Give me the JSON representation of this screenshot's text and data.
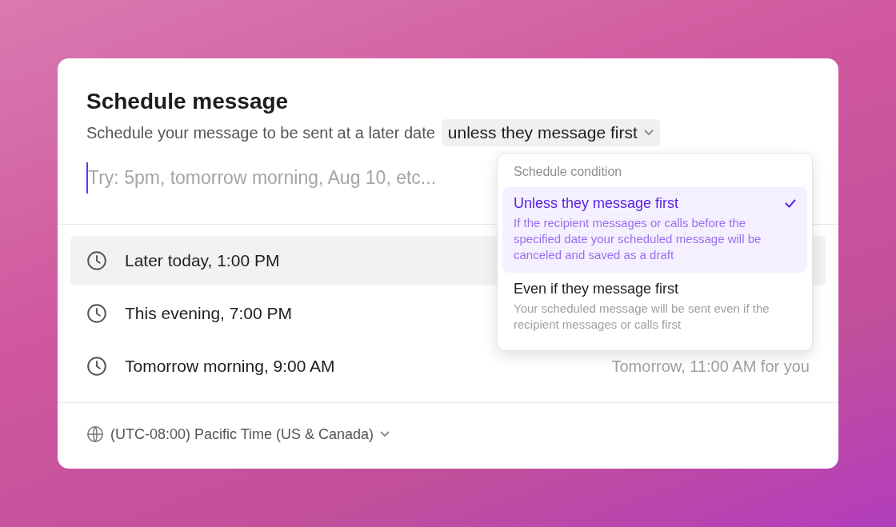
{
  "dialog": {
    "title": "Schedule message",
    "subtitle": "Schedule your message to be sent at a later date",
    "condition_button": "unless they message first",
    "input": {
      "placeholder": "Try: 5pm, tomorrow morning, Aug 10, etc..."
    }
  },
  "options": [
    {
      "label": "Later today, 1:00 PM",
      "selected": true
    },
    {
      "label": "This evening, 7:00 PM",
      "selected": false
    },
    {
      "label": "Tomorrow morning, 9:00 AM",
      "selected": false,
      "local_time": "Tomorrow, 11:00 AM for you"
    }
  ],
  "timezone": "(UTC-08:00) Pacific Time (US & Canada)",
  "menu": {
    "heading": "Schedule condition",
    "items": [
      {
        "title": "Unless they message first",
        "description": "If the recipient messages or calls before the specified date your scheduled message will be canceled and saved as a draft",
        "selected": true
      },
      {
        "title": "Even if they message first",
        "description": "Your scheduled message will be sent even if the recipient messages or calls first",
        "selected": false
      }
    ]
  }
}
